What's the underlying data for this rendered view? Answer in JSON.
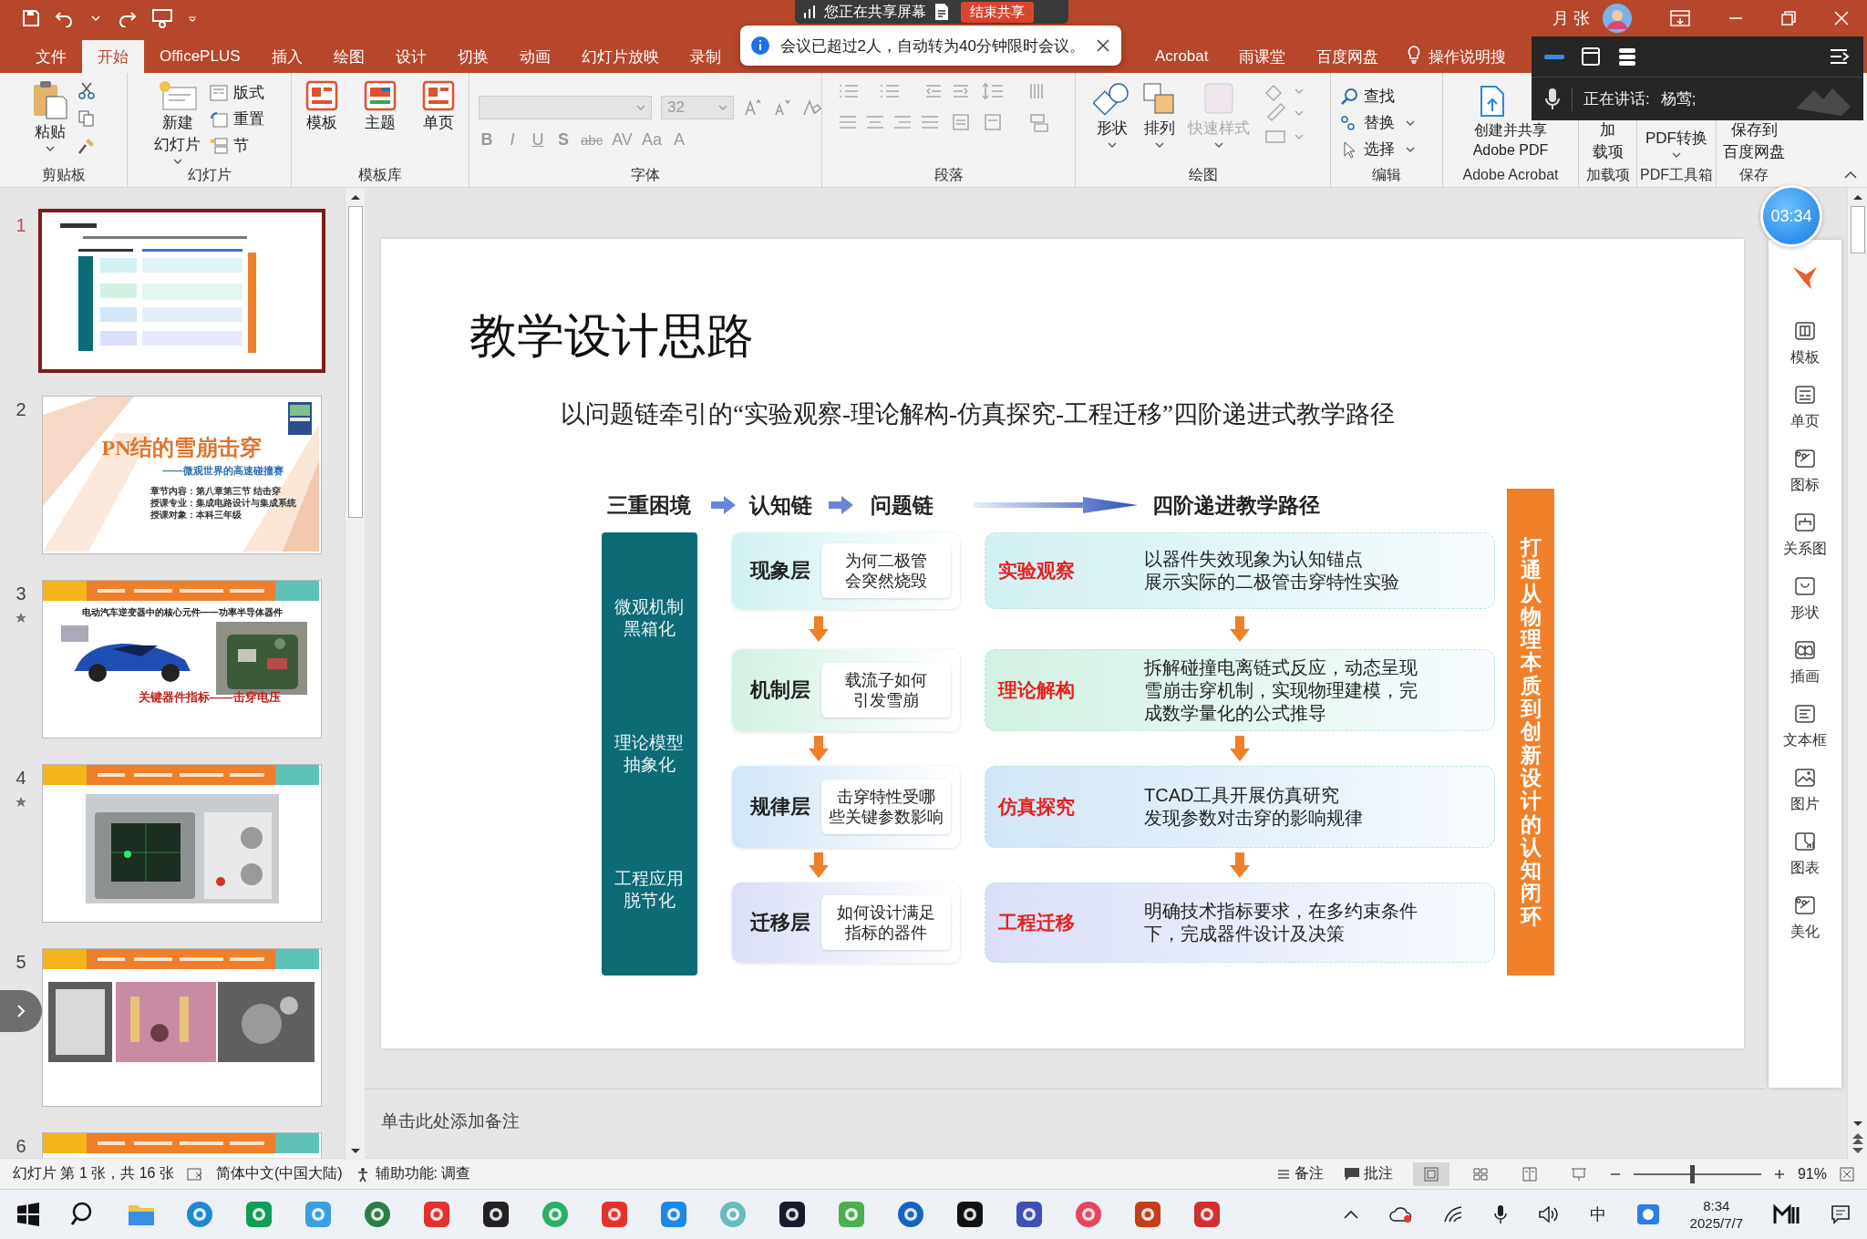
{
  "title_bar": {
    "share_status": "您正在共享屏幕",
    "end_share": "结束共享",
    "user": "月 张"
  },
  "tabs": [
    {
      "label": "文件",
      "kind": "tab",
      "selected": false
    },
    {
      "label": "开始",
      "kind": "tab",
      "selected": true
    },
    {
      "label": "OfficePLUS",
      "kind": "tab",
      "selected": false
    },
    {
      "label": "插入",
      "kind": "tab",
      "selected": false
    },
    {
      "label": "绘图",
      "kind": "tab",
      "selected": false
    },
    {
      "label": "设计",
      "kind": "tab",
      "selected": false
    },
    {
      "label": "切换",
      "kind": "tab",
      "selected": false
    },
    {
      "label": "动画",
      "kind": "tab",
      "selected": false
    },
    {
      "label": "幻灯片放映",
      "kind": "tab",
      "selected": false
    },
    {
      "label": "录制",
      "kind": "tab",
      "selected": false
    }
  ],
  "notification": {
    "text": "会议已超过2人，自动转为40分钟限时会议。"
  },
  "tabs_right": [
    {
      "label": "Acrobat",
      "kind": "tab",
      "selected": false
    },
    {
      "label": "雨课堂",
      "kind": "tab",
      "selected": false
    },
    {
      "label": "百度网盘",
      "kind": "tab",
      "selected": false
    },
    {
      "label": "操作说明搜",
      "kind": "search",
      "selected": false
    }
  ],
  "meeting_panel": {
    "speaking_label": "正在讲话:",
    "speaker": "杨莺;"
  },
  "ribbon": {
    "clipboard": {
      "label": "剪贴板",
      "paste": "粘贴"
    },
    "slides": {
      "label": "幻灯片",
      "new_slide": [
        "新建",
        "幻灯片"
      ],
      "layout": "版式",
      "reset": "重置",
      "section": "节"
    },
    "template_library": {
      "label": "模板库",
      "buttons": [
        "模板",
        "主题",
        "单页"
      ]
    },
    "font": {
      "label": "字体",
      "size": "32",
      "formatting": [
        "B",
        "I",
        "U",
        "S",
        "abc",
        "AV",
        "Aa",
        "A"
      ]
    },
    "paragraph": {
      "label": "段落"
    },
    "drawing": {
      "label": "绘图",
      "buttons": [
        {
          "text": "形状",
          "disabled": false
        },
        {
          "text": "排列",
          "disabled": false
        },
        {
          "text": "快速样式",
          "disabled": true
        }
      ]
    },
    "editing": {
      "label": "编辑",
      "buttons": [
        "查找",
        "替换",
        "选择"
      ]
    },
    "acrobat": {
      "label": "Adobe Acrobat",
      "button": [
        "创建并共享",
        "Adobe PDF"
      ]
    },
    "addins": {
      "label": "加载项",
      "button": [
        "加",
        "载项"
      ]
    },
    "pdf_tools": {
      "label": "PDF工具箱",
      "button": "PDF转换"
    },
    "save": {
      "label": "保存",
      "button": [
        "保存到",
        "百度网盘"
      ]
    }
  },
  "thumbnails": [
    {
      "number": "1",
      "kind": "diagram",
      "selected": true,
      "animated": false
    },
    {
      "number": "2",
      "kind": "title",
      "selected": false,
      "animated": false,
      "title": "PN结的雪崩击穿",
      "subtitle": "——微观世界的高速碰撞赛",
      "lines": [
        "章节内容：第八章第三节 结击穿",
        "授课专业：集成电路设计与集成系统",
        "授课对象：本科三年级"
      ]
    },
    {
      "number": "3",
      "kind": "photo-caption",
      "selected": false,
      "animated": true,
      "heading": "电动汽车逆变器中的核心元件——功率半导体器件",
      "caption": "关键器件指标——击穿电压"
    },
    {
      "number": "4",
      "selected": false,
      "animated": true
    },
    {
      "number": "5",
      "kind": "photos",
      "selected": false,
      "animated": false
    },
    {
      "number": "6",
      "kind": "nav",
      "selected": false,
      "animated": false
    }
  ],
  "slide": {
    "title": "教学设计思路",
    "subtitle": "以问题链牵引的“实验观察-理论解构-仿真探究-工程迁移”四阶递进式教学路径",
    "headers": [
      "三重困境",
      "认知链",
      "问题链",
      "四阶递进教学路径"
    ],
    "dilemmas": [
      "微观机制黑箱化",
      "理论模型抽象化",
      "工程应用脱节化"
    ],
    "layers": [
      {
        "layer": "现象层",
        "question": [
          "为何二极管",
          "会突然烧毁"
        ],
        "stage": "实验观察",
        "description": [
          "以器件失效现象为认知锚点",
          "展示实际的二极管击穿特性实验"
        ],
        "color": "#d2f1f2"
      },
      {
        "layer": "机制层",
        "question": [
          "载流子如何",
          "引发雪崩"
        ],
        "stage": "理论解构",
        "description": [
          "拆解碰撞电离链式反应，动态呈现",
          "雪崩击穿机制，实现物理建模，完",
          "成数学量化的公式推导"
        ],
        "color": "#d3f2e3"
      },
      {
        "layer": "规律层",
        "question": [
          "击穿特性受哪",
          "些关键参数影响"
        ],
        "stage": "仿真探究",
        "description": [
          "TCAD工具开展仿真研究",
          "发现参数对击穿的影响规律"
        ],
        "color": "#d2e6f7"
      },
      {
        "layer": "迁移层",
        "question": [
          "如何设计满足",
          "指标的器件"
        ],
        "stage": "工程迁移",
        "description": [
          "明确技术指标要求，在多约束条件",
          "下，完成器件设计及决策"
        ],
        "color": "#dadff7"
      }
    ],
    "banner": "打通从物理本质到创新设计的认知闭环"
  },
  "notes_placeholder": "单击此处添加备注",
  "timer": "03:34",
  "side_panel": [
    "模板",
    "单页",
    "图标",
    "关系图",
    "形状",
    "插画",
    "文本框",
    "图片",
    "图表",
    "美化"
  ],
  "status_bar": {
    "slide_info": "幻灯片 第 1 张，共 16 张",
    "language": "简体中文(中国大陆)",
    "accessibility": "辅助功能: 调查",
    "notes": "备注",
    "comments": "批注",
    "zoom": "91%",
    "zoom_slider": {
      "level": 0.46
    }
  },
  "taskbar": {
    "ime": "中",
    "time": "8:34",
    "date": "2025/7/7"
  }
}
